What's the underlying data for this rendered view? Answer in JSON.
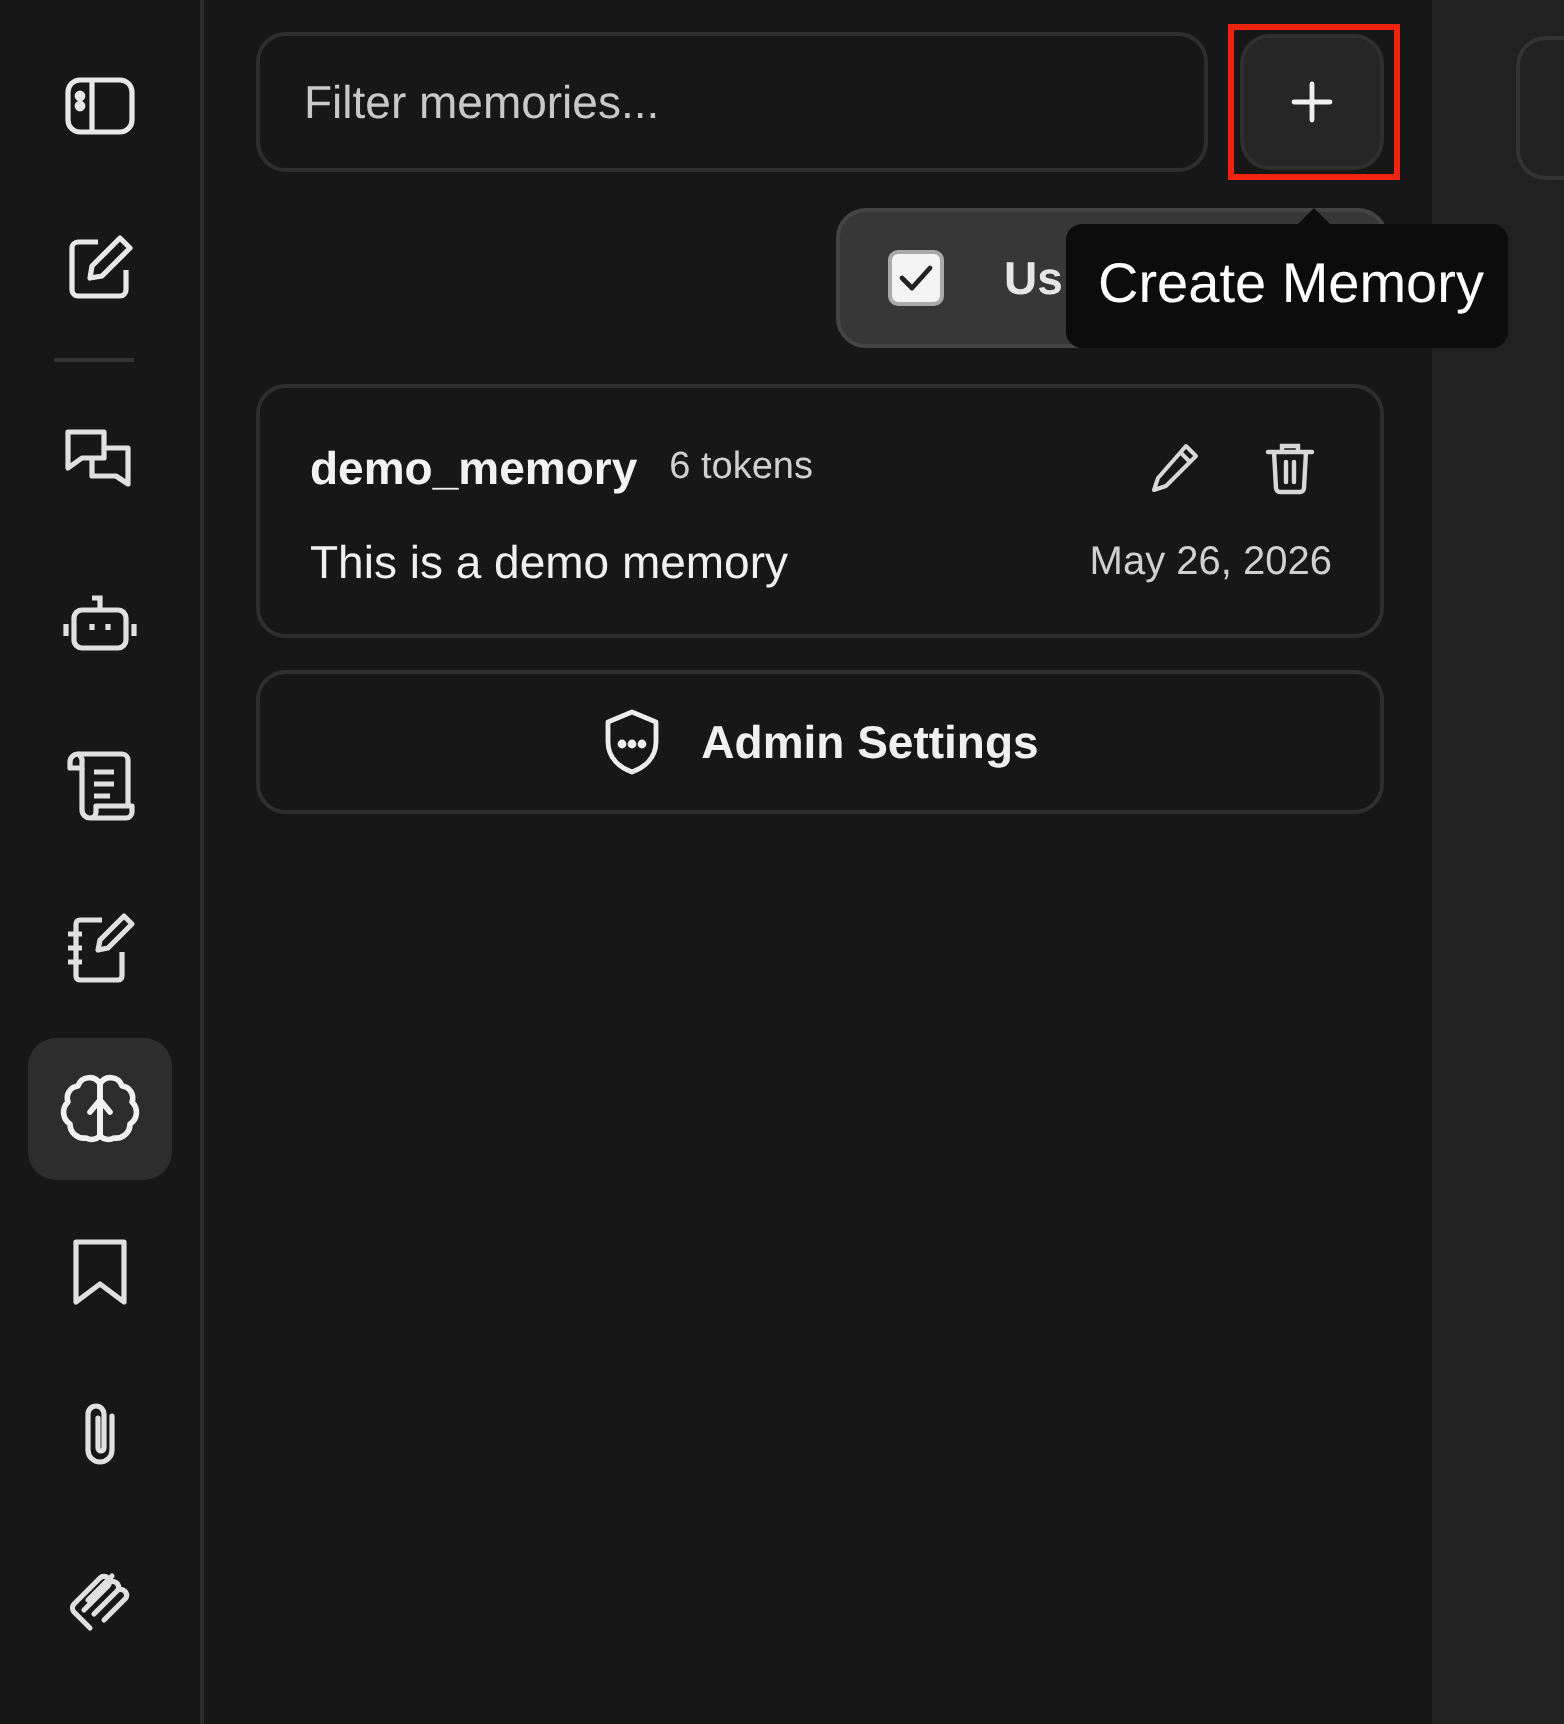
{
  "rail": {
    "top_buttons": [
      {
        "selected": false
      },
      {
        "selected": false
      }
    ],
    "items": [
      {
        "selected": false
      },
      {
        "selected": false
      },
      {
        "selected": false
      },
      {
        "selected": false
      },
      {
        "selected": true
      },
      {
        "selected": false
      },
      {
        "selected": false
      },
      {
        "selected": false
      }
    ]
  },
  "filter": {
    "placeholder": "Filter memories..."
  },
  "create_button": {
    "highlighted": true
  },
  "tooltip": {
    "text": "Create Memory"
  },
  "use_memory_toggle": {
    "label": "Us",
    "checked": true
  },
  "memories": [
    {
      "name": "demo_memory",
      "tokens": "6 tokens",
      "content": "This is a demo memory",
      "date": "May 26, 2026"
    }
  ],
  "admin_button": {
    "label": "Admin Settings"
  }
}
